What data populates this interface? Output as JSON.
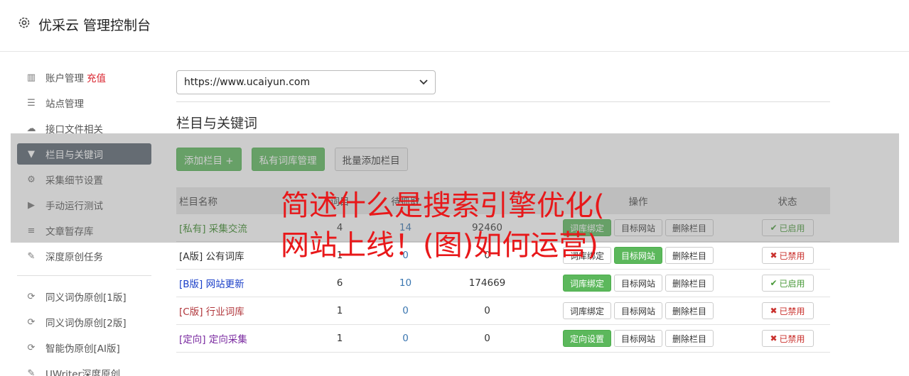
{
  "header": {
    "title": "优采云 管理控制台",
    "icon": "gear-icon"
  },
  "sidebar": {
    "items": [
      {
        "icon": "bar-chart-icon",
        "glyph": "▥",
        "label": "账户管理",
        "extra": "充值"
      },
      {
        "icon": "server-icon",
        "glyph": "☰",
        "label": "站点管理"
      },
      {
        "icon": "cloud-upload-icon",
        "glyph": "☁",
        "label": "接口文件相关"
      },
      {
        "icon": "filter-icon",
        "glyph": "▼",
        "label": "栏目与关键词",
        "active": true
      },
      {
        "icon": "cogs-icon",
        "glyph": "⚙",
        "label": "采集细节设置"
      },
      {
        "icon": "play-circle-icon",
        "glyph": "▶",
        "label": "手动运行测试"
      },
      {
        "icon": "database-icon",
        "glyph": "≡",
        "label": "文章暂存库"
      },
      {
        "icon": "edit-icon",
        "glyph": "✎",
        "label": "深度原创任务"
      }
    ],
    "items2": [
      {
        "icon": "refresh-icon",
        "glyph": "⟳",
        "label": "同义词伪原创[1版]"
      },
      {
        "icon": "refresh-icon",
        "glyph": "⟳",
        "label": "同义词伪原创[2版]"
      },
      {
        "icon": "refresh-icon",
        "glyph": "⟳",
        "label": "智能伪原创[AI版]"
      },
      {
        "icon": "edit-icon",
        "glyph": "✎",
        "label": "UWriter深度原创"
      }
    ]
  },
  "site_select": {
    "value": "https://www.ucaiyun.com"
  },
  "section": {
    "title": "栏目与关键词"
  },
  "toolbar": {
    "add_column": "添加栏目 +",
    "private_lib": "私有词库管理",
    "batch_add": "批量添加栏目"
  },
  "table": {
    "headers": {
      "name": "栏目名称",
      "n1": "词目",
      "n2": "待抓取",
      "n3": "",
      "ops": "操作",
      "status": "状态"
    },
    "rows": [
      {
        "name": "[私有] 采集交流",
        "color": "#3a8a2a",
        "n1": "4",
        "n2": "14",
        "n3": "92460",
        "op1": "词库绑定",
        "op1_green": true,
        "op2": "目标网站",
        "op2_green": false,
        "op3": "删除栏目",
        "status": "已启用",
        "on": true
      },
      {
        "name": "[A版] 公有词库",
        "color": "#333333",
        "n1": "1",
        "n2": "0",
        "n3": "0",
        "op1": "词库绑定",
        "op1_green": false,
        "op2": "目标网站",
        "op2_green": true,
        "op3": "删除栏目",
        "status": "已禁用",
        "on": false
      },
      {
        "name": "[B版] 网站更新",
        "color": "#1a3fc8",
        "n1": "6",
        "n2": "10",
        "n3": "174669",
        "op1": "词库绑定",
        "op1_green": true,
        "op2": "目标网站",
        "op2_green": false,
        "op3": "删除栏目",
        "status": "已启用",
        "on": true
      },
      {
        "name": "[C版] 行业词库",
        "color": "#b0353a",
        "n1": "1",
        "n2": "0",
        "n3": "0",
        "op1": "词库绑定",
        "op1_green": false,
        "op2": "目标网站",
        "op2_green": false,
        "op3": "删除栏目",
        "status": "已禁用",
        "on": false
      },
      {
        "name": "[定向] 定向采集",
        "color": "#7a2aa0",
        "n1": "1",
        "n2": "0",
        "n3": "0",
        "op1": "定向设置",
        "op1_green": true,
        "op2": "目标网站",
        "op2_green": false,
        "op3": "删除栏目",
        "status": "已禁用",
        "on": false
      }
    ]
  },
  "overlay": {
    "line1": "简述什么是搜索引擎优化(",
    "line2": "网站上线！(图)如何运营)"
  }
}
